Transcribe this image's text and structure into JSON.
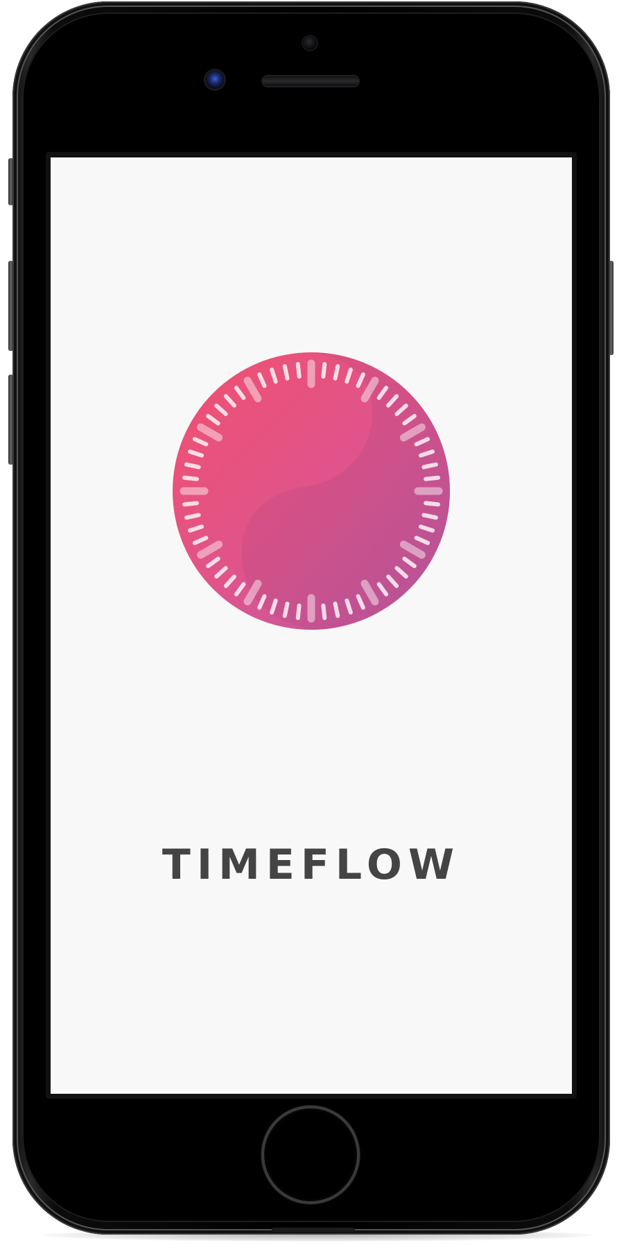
{
  "app": {
    "title": "TIMEFLOW"
  },
  "colors": {
    "screen_background": "#f8f8f8",
    "title_text": "#444444",
    "logo_gradient_start": "#f0506e",
    "logo_gradient_end": "#b55aa8",
    "tick_marks": "#ffffff"
  },
  "icons": {
    "logo": "clock-dial-icon",
    "home": "home-button",
    "camera": "front-camera-icon",
    "speaker": "speaker-grille"
  }
}
